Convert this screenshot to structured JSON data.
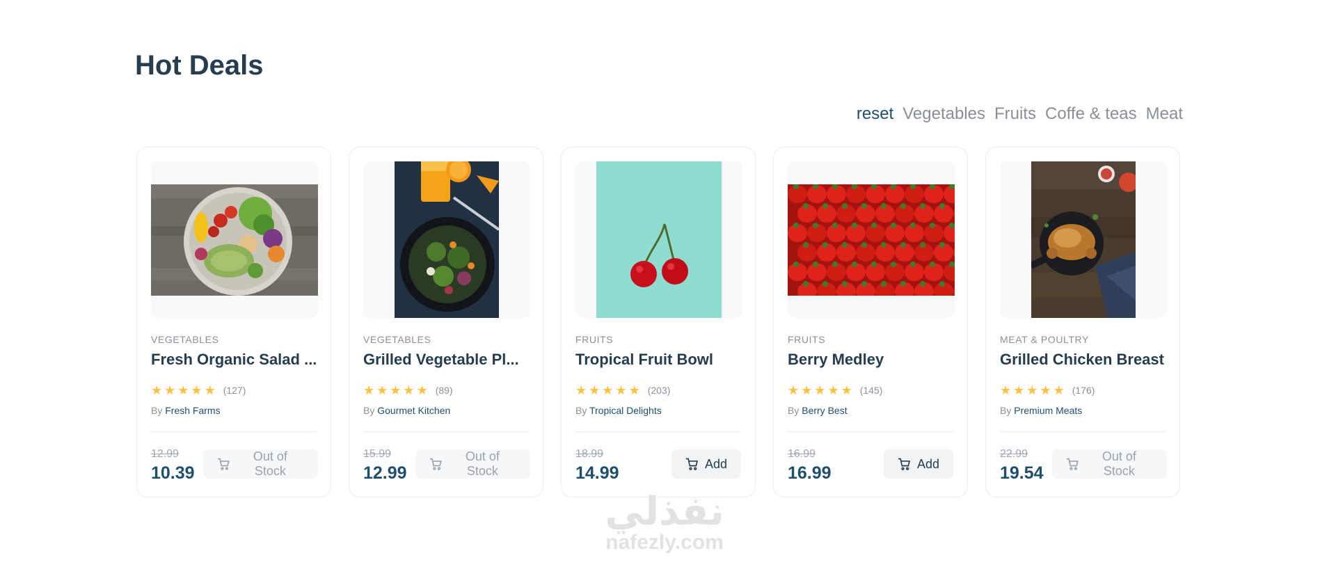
{
  "header": {
    "title": "Hot Deals"
  },
  "filters": [
    "reset",
    "Vegetables",
    "Fruits",
    "Coffe & teas",
    "Meat"
  ],
  "active_filter": "reset",
  "products": [
    {
      "category": "VEGETABLES",
      "name": "Fresh Organic Salad ...",
      "rating_count": "(127)",
      "by": "By",
      "vendor": "Fresh Farms",
      "old_price": "12.99",
      "price": "10.39",
      "button_label": "Out of Stock",
      "button_state": "out-of-stock",
      "image": "salad-bowl-photo"
    },
    {
      "category": "VEGETABLES",
      "name": "Grilled Vegetable Pl...",
      "rating_count": "(89)",
      "by": "By",
      "vendor": "Gourmet Kitchen",
      "old_price": "15.99",
      "price": "12.99",
      "button_label": "Out of Stock",
      "button_state": "out-of-stock",
      "image": "vegetable-plate-photo"
    },
    {
      "category": "FRUITS",
      "name": "Tropical Fruit Bowl",
      "rating_count": "(203)",
      "by": "By",
      "vendor": "Tropical Delights",
      "old_price": "18.99",
      "price": "14.99",
      "button_label": "Add",
      "button_state": "available",
      "image": "cherries-photo"
    },
    {
      "category": "FRUITS",
      "name": "Berry Medley",
      "rating_count": "(145)",
      "by": "By",
      "vendor": "Berry Best",
      "old_price": "16.99",
      "price": "16.99",
      "button_label": "Add",
      "button_state": "available",
      "image": "strawberries-photo"
    },
    {
      "category": "MEAT & POULTRY",
      "name": "Grilled Chicken Breast",
      "rating_count": "(176)",
      "by": "By",
      "vendor": "Premium Meats",
      "old_price": "22.99",
      "price": "19.54",
      "button_label": "Out of Stock",
      "button_state": "out-of-stock",
      "image": "roast-chicken-photo"
    }
  ],
  "rating_stars": 5,
  "watermark": {
    "arabic": "نفذلي",
    "latin": "nafezly.com"
  },
  "colors": {
    "title": "#253d4e",
    "accent": "#1f4f6b",
    "star": "#fdc040",
    "muted": "#8a9198"
  }
}
